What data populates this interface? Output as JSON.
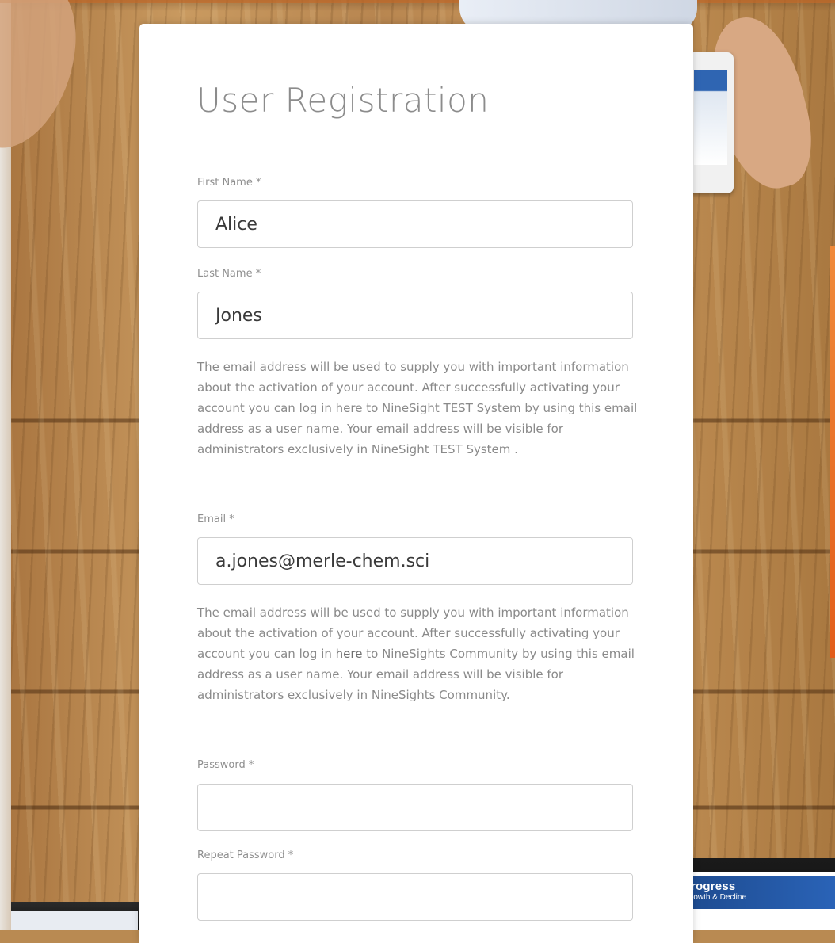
{
  "form": {
    "title": "User Registration",
    "first_name": {
      "label": "First Name *",
      "value": "Alice"
    },
    "last_name": {
      "label": "Last Name *",
      "value": "Jones"
    },
    "help_1": "The email address will be used to supply you with important information about the activation of your account. After successfully activating your account you can log in here to NineSight TEST System by using this email address as a user name. Your email address will be visible for administrators exclusively in NineSight TEST System .",
    "email": {
      "label": "Email *",
      "value": "a.jones@merle-chem.sci"
    },
    "help_2": {
      "before": "The email address will be used to supply you with important information about the activation of your account. After successfully activating your account you can log in ",
      "link": "here",
      "after": " to NineSights Community by using this email address as a user name. Your email address will be visible for administrators exclusively in NineSights Community."
    },
    "password": {
      "label": "Password *",
      "value": ""
    },
    "repeat_password": {
      "label": "Repeat Password *",
      "value": ""
    }
  },
  "background": {
    "laptop_banner_title": "rogress",
    "laptop_banner_sub": "rowth & Decline"
  }
}
